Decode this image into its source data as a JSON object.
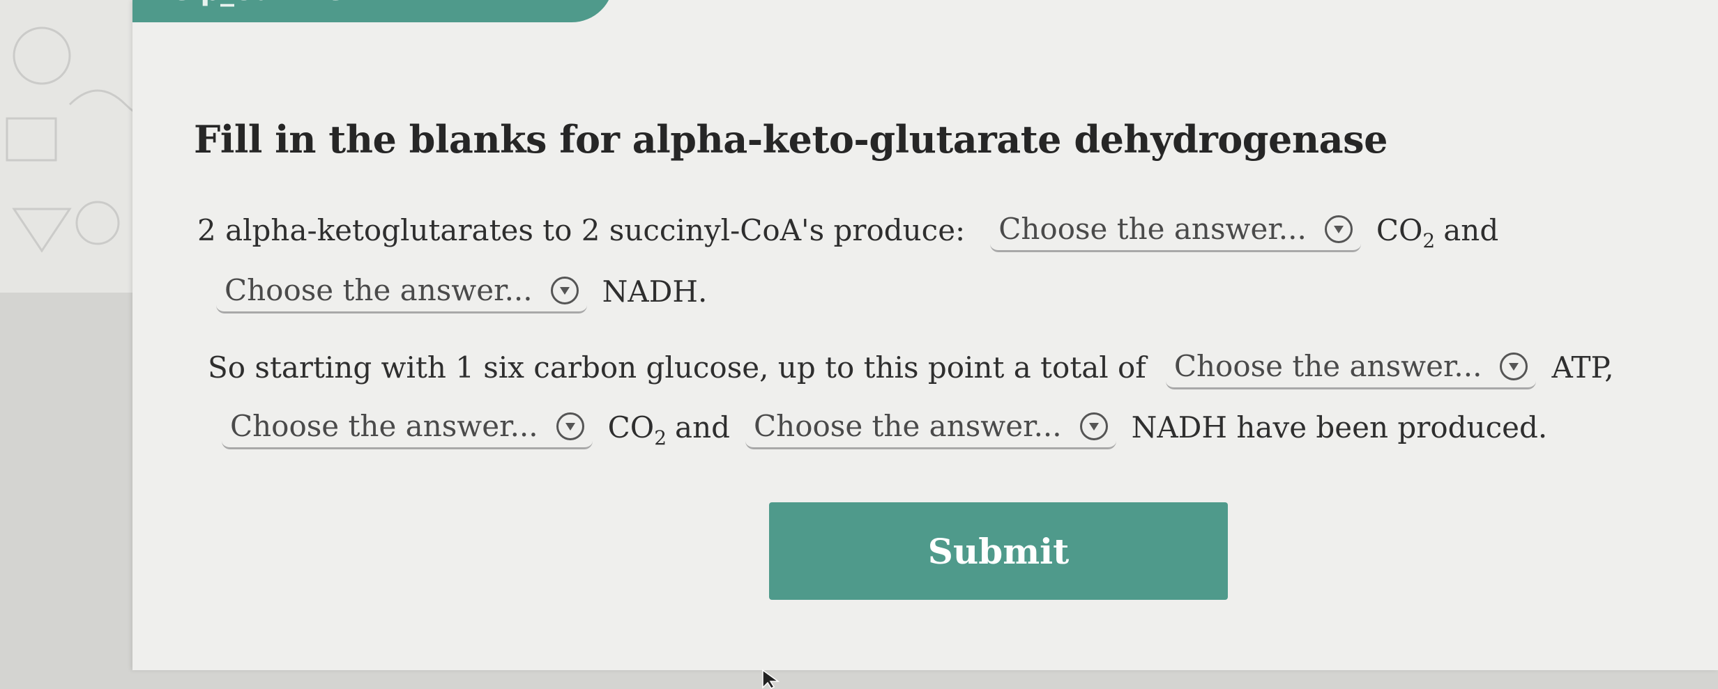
{
  "top_tab": {
    "label": "help_outline"
  },
  "heading": "Fill in the blanks for alpha-keto-glutarate dehydrogenase",
  "dropdown_placeholder": "Choose the answer...",
  "icons": {
    "dropdown": "chevron-down-circle-icon",
    "cursor": "mouse-pointer-icon"
  },
  "question1": {
    "text_before": "2 alpha-ketoglutarates to 2 succinyl-CoA's produce:",
    "co2_main": "CO",
    "co2_sub": "2",
    "and": "and",
    "nadh_end": "NADH."
  },
  "question2": {
    "text_before": "So starting with 1 six carbon glucose, up to this point a total of",
    "atp": "ATP,",
    "co2_main": "CO",
    "co2_sub": "2",
    "and": "and",
    "nadh_end": "NADH have been produced."
  },
  "submit_label": "Submit",
  "colors": {
    "accent": "#4f9a8b",
    "card_background": "#efefed",
    "text": "#2e2e2e"
  }
}
